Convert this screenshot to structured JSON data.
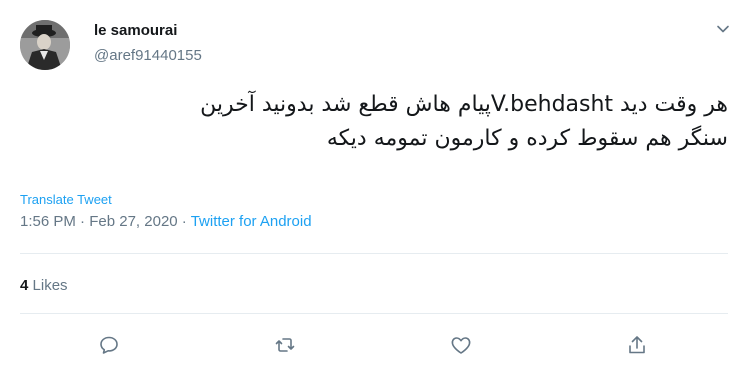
{
  "user": {
    "name": "le samourai",
    "handle": "@aref91440155"
  },
  "tweet": {
    "line1_part_rtl": "هر وقت دید ",
    "line1_mention": "V.behdasht",
    "line1_rest": "پیام هاش قطع شد بدونید آخرین",
    "line2": "سنگر هم سقوط کرده و کارمون تمومه دیکه"
  },
  "translate_label": "Translate Tweet",
  "meta": {
    "time": "1:56 PM",
    "sep1": " · ",
    "date": "Feb 27, 2020",
    "sep2": " · ",
    "source": "Twitter for Android"
  },
  "likes": {
    "count": "4",
    "label": "Likes"
  },
  "icons": {
    "reply": "reply-icon",
    "retweet": "retweet-icon",
    "like": "heart-icon",
    "share": "share-icon",
    "menu": "chevron-down-icon"
  },
  "colors": {
    "accent": "#1da1f2",
    "secondary_text": "#657786",
    "divider": "#e6ecf0"
  }
}
